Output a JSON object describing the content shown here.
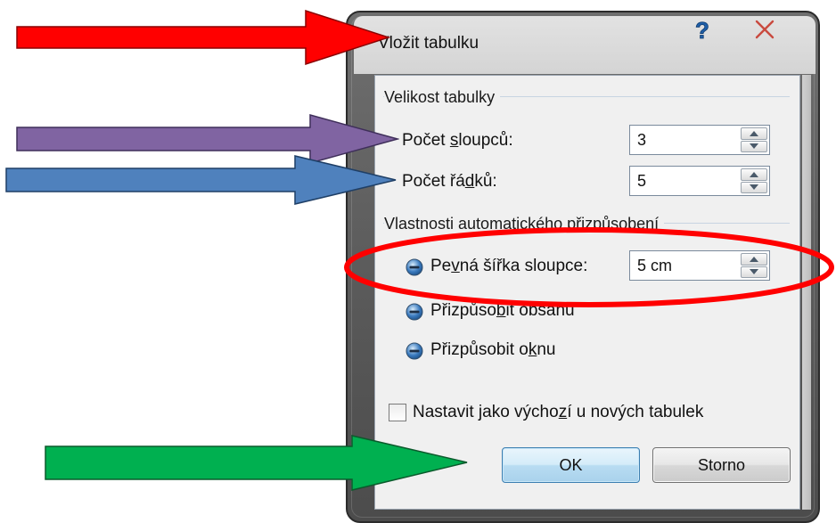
{
  "dialog": {
    "title": "Vložit tabulku",
    "help_glyph": "?",
    "close_glyph": "✕"
  },
  "size_group": {
    "label": "Velikost tabulky",
    "columns": {
      "label_prefix": "Počet ",
      "label_mnemonic": "s",
      "label_suffix": "loupců:",
      "value": "3"
    },
    "rows": {
      "label_prefix": "Počet řá",
      "label_mnemonic": "d",
      "label_suffix": "ků:",
      "value": "5"
    }
  },
  "autofit_group": {
    "label": "Vlastnosti automatického přizpůsobení",
    "fixed_width": {
      "label_prefix": "Pe",
      "label_mnemonic": "v",
      "label_suffix": "ná šířka sloupce:",
      "value": "5 cm",
      "selected": true
    },
    "fit_contents": {
      "label_prefix": "Přizpůso",
      "label_mnemonic": "b",
      "label_suffix": "it obsahu"
    },
    "fit_window": {
      "label_prefix": "Přizpůsobit o",
      "label_mnemonic": "k",
      "label_suffix": "nu"
    }
  },
  "default_checkbox": {
    "label_prefix": "Nastavit jako výcho",
    "label_mnemonic": "z",
    "label_suffix": "í u nových tabulek",
    "checked": false
  },
  "buttons": {
    "ok": "OK",
    "cancel": "Storno"
  },
  "annotations": {
    "arrow_title_color": "#ff0000",
    "arrow_columns_color": "#8064a2",
    "arrow_rows_color": "#4f81bd",
    "arrow_ok_color": "#00b050",
    "highlight_ellipse_color": "#ff0000"
  },
  "colors": {
    "dialog_frame": "#5a5a5a",
    "client_background": "#f0f0f0",
    "ok_button_tint": "#b8dcf2",
    "close_icon": "#c94a3f",
    "help_icon": "#1f5fa8"
  }
}
